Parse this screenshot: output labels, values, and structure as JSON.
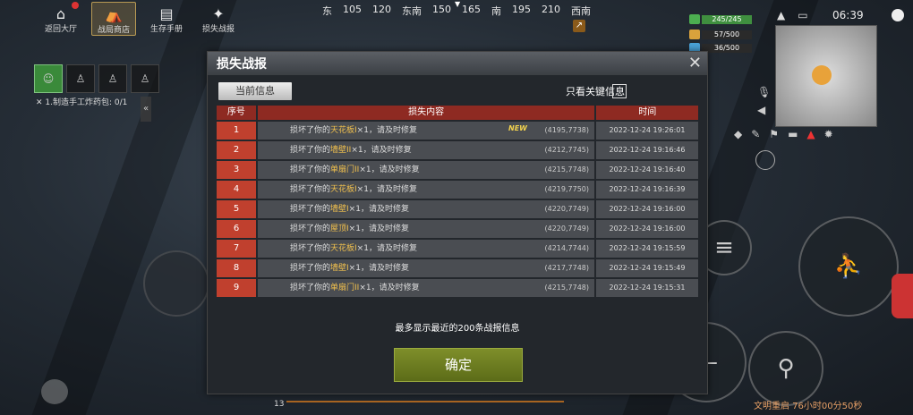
{
  "nav": [
    {
      "label": "返回大厅",
      "glyph": "⌂",
      "badge": "●"
    },
    {
      "label": "战局商店",
      "glyph": "⛺",
      "active": true
    },
    {
      "label": "生存手册",
      "glyph": "▤"
    },
    {
      "label": "损失战报",
      "glyph": "✦"
    }
  ],
  "compass": [
    "东",
    "105",
    "120",
    "东南",
    "150",
    "165",
    "南",
    "195",
    "210",
    "西南"
  ],
  "compass_marker": "▼",
  "status": {
    "health": "245/245",
    "armor": "57/500",
    "water": "36/500",
    "time": "06:39"
  },
  "task_line": "1.制造手工炸药包: 0/1",
  "collapse": "«",
  "bottom_right": "文明重启 76小时00分50秒",
  "bottom_count": "13",
  "modal": {
    "title": "损失战报",
    "close": "✕",
    "tab_current": "当前信息",
    "key_only": "只看关键信息",
    "headers": [
      "序号",
      "损失内容",
      "时间"
    ],
    "rows": [
      {
        "idx": "1",
        "attacker": "",
        "text_pre": "损坏了你的",
        "item": "天花板I",
        "qty": "×1，请及时修复",
        "coord": "(4195,7738)",
        "time": "2022-12-24 19:26:01",
        "new": "NEW"
      },
      {
        "idx": "2",
        "attacker": "",
        "text_pre": "损坏了你的",
        "item": "墙壁II",
        "qty": "×1，请及时修复",
        "coord": "(4212,7745)",
        "time": "2022-12-24 19:16:46"
      },
      {
        "idx": "3",
        "attacker": "",
        "text_pre": "损坏了你的",
        "item": "单扇门II",
        "qty": "×1，请及时修复",
        "coord": "(4215,7748)",
        "time": "2022-12-24 19:16:40"
      },
      {
        "idx": "4",
        "attacker": "",
        "text_pre": "损坏了你的",
        "item": "天花板I",
        "qty": "×1，请及时修复",
        "coord": "(4219,7750)",
        "time": "2022-12-24 19:16:39"
      },
      {
        "idx": "5",
        "attacker": "",
        "text_pre": "损坏了你的",
        "item": "墙壁I",
        "qty": "×1，请及时修复",
        "coord": "(4220,7749)",
        "time": "2022-12-24 19:16:00"
      },
      {
        "idx": "6",
        "attacker": "",
        "text_pre": "损坏了你的",
        "item": "屋顶I",
        "qty": "×1，请及时修复",
        "coord": "(4220,7749)",
        "time": "2022-12-24 19:16:00"
      },
      {
        "idx": "7",
        "attacker": "",
        "text_pre": "损坏了你的",
        "item": "天花板I",
        "qty": "×1，请及时修复",
        "coord": "(4214,7744)",
        "time": "2022-12-24 19:15:59"
      },
      {
        "idx": "8",
        "attacker": "",
        "text_pre": "损坏了你的",
        "item": "墙壁I",
        "qty": "×1，请及时修复",
        "coord": "(4217,7748)",
        "time": "2022-12-24 19:15:49"
      },
      {
        "idx": "9",
        "attacker": "",
        "text_pre": "损坏了你的",
        "item": "单扇门II",
        "qty": "×1，请及时修复",
        "coord": "(4215,7748)",
        "time": "2022-12-24 19:15:31"
      }
    ],
    "footer_note": "最多显示最近的200条战报信息",
    "confirm": "确定"
  }
}
